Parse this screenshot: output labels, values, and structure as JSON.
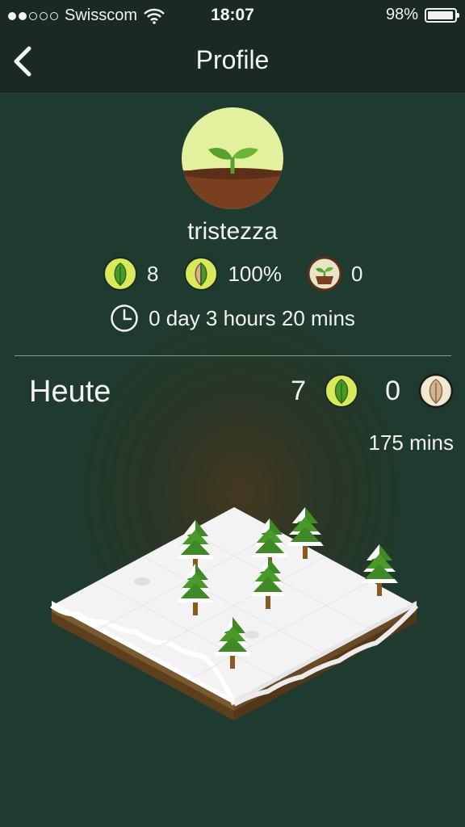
{
  "status_bar": {
    "carrier": "Swisscom",
    "time": "18:07",
    "battery_text": "98%",
    "battery_level": 0.98,
    "signal_bars_filled": 2,
    "signal_bars_total": 5
  },
  "nav": {
    "title": "Profile",
    "back_icon": "chevron-left-icon"
  },
  "profile": {
    "username": "tristezza",
    "stats": {
      "healthy_trees": "8",
      "success_rate": "100%",
      "dead_trees": "0"
    },
    "focus_time": "0 day 3 hours 20 mins"
  },
  "today": {
    "label": "Heute",
    "healthy_trees": "7",
    "dead_trees": "0",
    "minutes": "175 mins"
  },
  "colors": {
    "background": "#1f3a2e",
    "bar": "#1a2a23",
    "leaf_green": "#5aa02c",
    "accent_yellow": "#d9e95a",
    "dead_leaf": "#d4b48c"
  }
}
